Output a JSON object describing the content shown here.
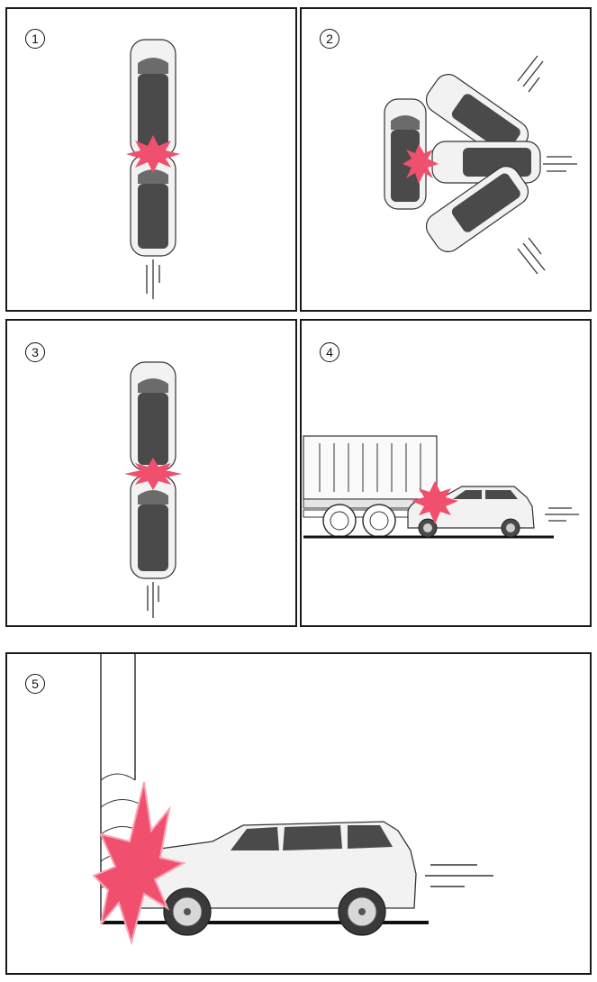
{
  "panels": [
    {
      "number": "1"
    },
    {
      "number": "2"
    },
    {
      "number": "3"
    },
    {
      "number": "4"
    },
    {
      "number": "5"
    }
  ],
  "colors": {
    "impact_burst": "#f0506e",
    "impact_burst_light": "#f7a6b6",
    "car_body": "#f2f2f2",
    "car_glass": "#4a4a4a",
    "outline": "#1a1a1a"
  },
  "icons": [
    "collision-burst-icon",
    "motion-lines-icon"
  ]
}
